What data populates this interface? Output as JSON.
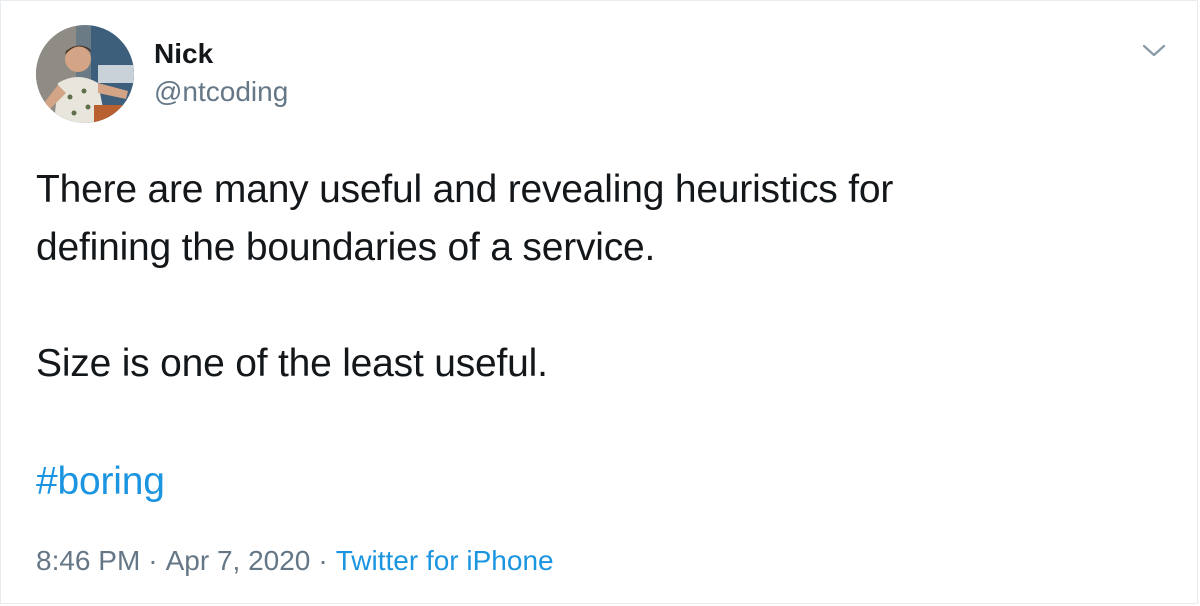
{
  "author": {
    "name": "Nick",
    "handle": "@ntcoding",
    "avatar": "avatar-photo"
  },
  "tweet": {
    "lines": [
      "There are many useful and revealing heuristics for",
      "defining the boundaries of a service.",
      "",
      "Size is one of the least useful."
    ],
    "hashtag": "#boring"
  },
  "meta": {
    "time": "8:46 PM",
    "separator": "·",
    "date": "Apr 7, 2020",
    "source": "Twitter for iPhone"
  },
  "icons": {
    "menu": "chevron-down-icon"
  },
  "colors": {
    "text": "#14171a",
    "secondary": "#657786",
    "link": "#1b95e0",
    "border": "#e6ecf0"
  }
}
